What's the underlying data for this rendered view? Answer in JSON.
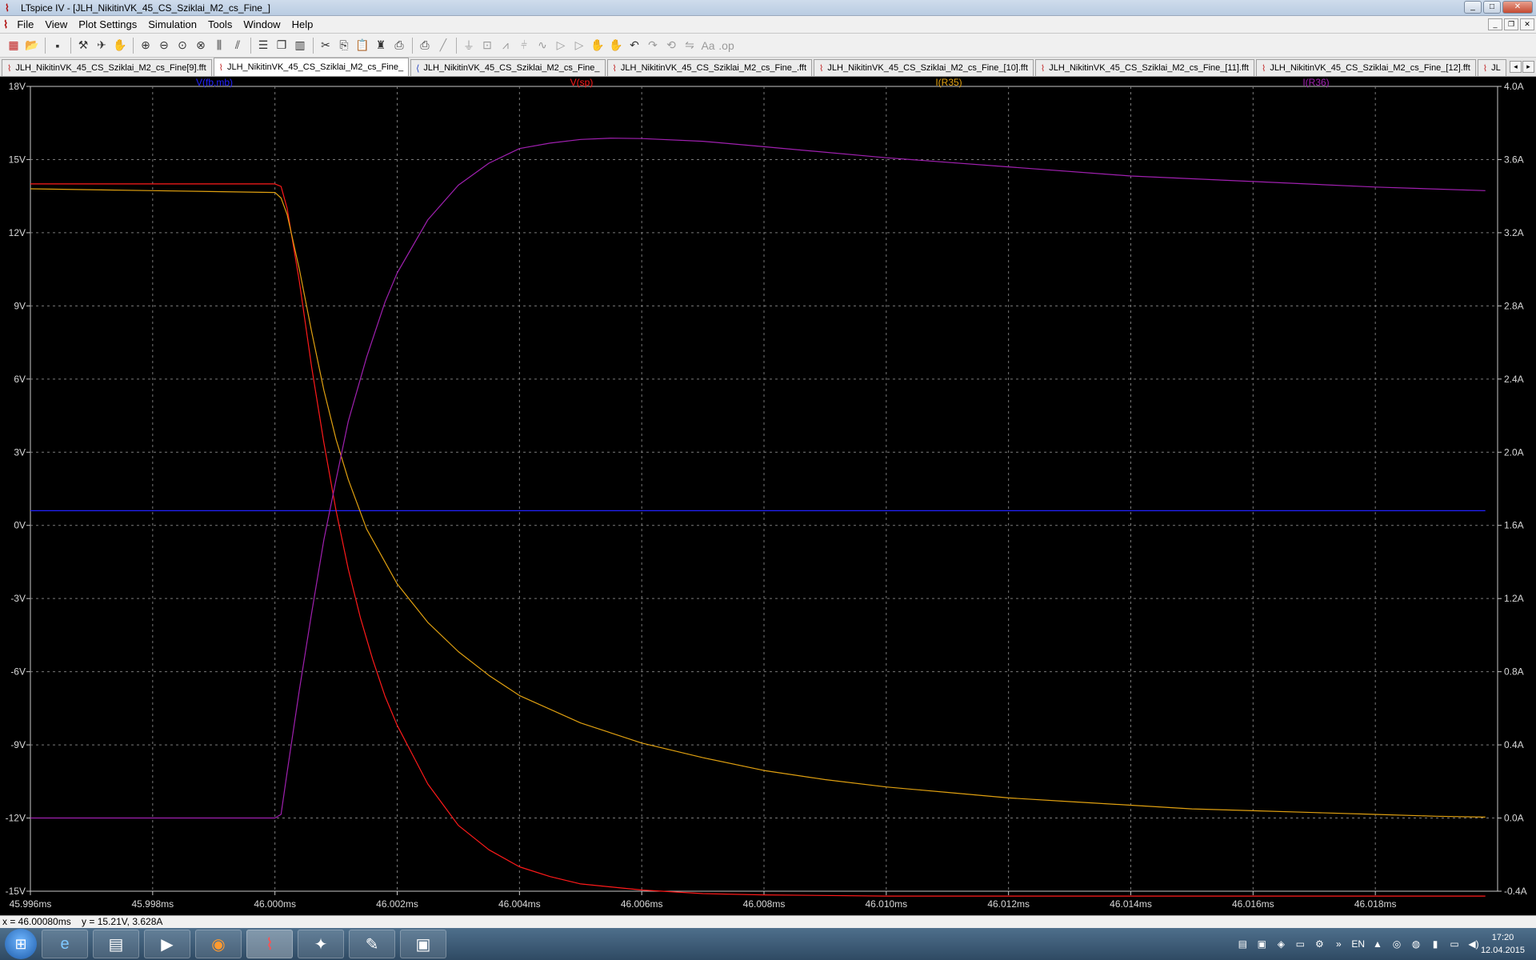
{
  "window": {
    "title": "LTspice IV - [JLH_NikitinVK_45_CS_Sziklai_M2_cs_Fine_]"
  },
  "menu": [
    "File",
    "View",
    "Plot Settings",
    "Simulation",
    "Tools",
    "Window",
    "Help"
  ],
  "toolbar_icons": [
    "new-schematic-icon",
    "open-icon",
    "save-icon",
    "control-panel-icon",
    "run-icon",
    "halt-icon",
    "zoom-in-icon",
    "zoom-out-icon",
    "zoom-full-icon",
    "zoom-cancel-icon",
    "autorange-icon",
    "autorange-y-icon",
    "tile-horizontal-icon",
    "cascade-icon",
    "tile-vertical-icon",
    "cut-icon",
    "copy-icon",
    "paste-icon",
    "find-icon",
    "print-preview-icon",
    "print-icon",
    "wire-icon",
    "ground-icon",
    "label-icon",
    "resistor-icon",
    "capacitor-icon",
    "inductor-icon",
    "diode-icon",
    "component-icon",
    "move-icon",
    "drag-icon",
    "undo-icon",
    "redo-icon",
    "rotate-icon",
    "mirror-icon",
    "text-icon",
    "spice-directive-icon"
  ],
  "tabs": [
    {
      "label": "JLH_NikitinVK_45_CS_Sziklai_M2_cs_Fine[9].fft",
      "active": false,
      "icon": "waveform-icon"
    },
    {
      "label": "JLH_NikitinVK_45_CS_Sziklai_M2_cs_Fine_",
      "active": true,
      "icon": "waveform-icon"
    },
    {
      "label": "JLH_NikitinVK_45_CS_Sziklai_M2_cs_Fine_",
      "active": false,
      "icon": "schematic-icon"
    },
    {
      "label": "JLH_NikitinVK_45_CS_Sziklai_M2_cs_Fine_.fft",
      "active": false,
      "icon": "waveform-icon"
    },
    {
      "label": "JLH_NikitinVK_45_CS_Sziklai_M2_cs_Fine_[10].fft",
      "active": false,
      "icon": "waveform-icon"
    },
    {
      "label": "JLH_NikitinVK_45_CS_Sziklai_M2_cs_Fine_[11].fft",
      "active": false,
      "icon": "waveform-icon"
    },
    {
      "label": "JLH_NikitinVK_45_CS_Sziklai_M2_cs_Fine_[12].fft",
      "active": false,
      "icon": "waveform-icon"
    },
    {
      "label": "JL",
      "active": false,
      "icon": "waveform-icon"
    }
  ],
  "chart_data": {
    "type": "line",
    "title": "",
    "xlabel": "",
    "ylabel": "",
    "x_unit": "ms",
    "xlim": [
      45.996,
      46.02
    ],
    "x_ticks": [
      "45.996ms",
      "45.998ms",
      "46.000ms",
      "46.002ms",
      "46.004ms",
      "46.006ms",
      "46.008ms",
      "46.010ms",
      "46.012ms",
      "46.014ms",
      "46.016ms",
      "46.018ms"
    ],
    "y_left": {
      "lim": [
        -15,
        18
      ],
      "ticks": [
        "18V",
        "15V",
        "12V",
        "9V",
        "6V",
        "3V",
        "0V",
        "-3V",
        "-6V",
        "-9V",
        "-12V",
        "-15V"
      ]
    },
    "y_right": {
      "lim": [
        -0.4,
        4.0
      ],
      "ticks": [
        "4.0A",
        "3.6A",
        "3.2A",
        "2.8A",
        "2.4A",
        "2.0A",
        "1.6A",
        "1.2A",
        "0.8A",
        "0.4A",
        "0.0A",
        "-0.4A"
      ]
    },
    "grid": true,
    "background": "#000000",
    "grid_color": "#7a7a7a",
    "axis_color": "#c8c8c8",
    "series": [
      {
        "name": "V(fb,mb)",
        "color": "#2222ff",
        "axis": "left",
        "x": [
          45.996,
          46.0198
        ],
        "y": [
          0.6,
          0.6
        ]
      },
      {
        "name": "V(sp)",
        "color": "#ff1a1a",
        "axis": "left",
        "x": [
          45.996,
          45.998,
          46.0,
          46.0001,
          46.0002,
          46.0004,
          46.0006,
          46.0008,
          46.001,
          46.0012,
          46.0014,
          46.0016,
          46.0018,
          46.002,
          46.0025,
          46.003,
          46.0035,
          46.004,
          46.0045,
          46.005,
          46.006,
          46.007,
          46.008,
          46.01,
          46.012,
          46.014,
          46.016,
          46.0198
        ],
        "y": [
          14.0,
          14.0,
          14.0,
          13.9,
          13.0,
          10.0,
          6.5,
          3.4,
          0.6,
          -1.8,
          -3.8,
          -5.5,
          -7.0,
          -8.2,
          -10.6,
          -12.3,
          -13.3,
          -14.0,
          -14.4,
          -14.7,
          -14.95,
          -15.1,
          -15.15,
          -15.2,
          -15.2,
          -15.2,
          -15.2,
          -15.2
        ]
      },
      {
        "name": "I(R35)",
        "color": "#e0a010",
        "axis": "right",
        "x": [
          45.996,
          45.998,
          46.0,
          46.0001,
          46.0002,
          46.0004,
          46.0006,
          46.0008,
          46.001,
          46.0012,
          46.0015,
          46.002,
          46.0025,
          46.003,
          46.0035,
          46.004,
          46.005,
          46.006,
          46.007,
          46.008,
          46.009,
          46.01,
          46.011,
          46.012,
          46.013,
          46.014,
          46.015,
          46.016,
          46.017,
          46.018,
          46.019,
          46.0198
        ],
        "y": [
          3.44,
          3.43,
          3.42,
          3.39,
          3.3,
          3.0,
          2.66,
          2.34,
          2.07,
          1.85,
          1.58,
          1.28,
          1.07,
          0.91,
          0.78,
          0.67,
          0.52,
          0.41,
          0.33,
          0.26,
          0.21,
          0.17,
          0.14,
          0.11,
          0.09,
          0.07,
          0.05,
          0.04,
          0.03,
          0.02,
          0.01,
          0.005
        ]
      },
      {
        "name": "I(R36)",
        "color": "#a020b0",
        "axis": "right",
        "x": [
          45.996,
          45.998,
          46.0,
          46.0001,
          46.0002,
          46.0004,
          46.0006,
          46.0008,
          46.001,
          46.0012,
          46.0015,
          46.0018,
          46.002,
          46.0025,
          46.003,
          46.0035,
          46.004,
          46.0045,
          46.005,
          46.0055,
          46.006,
          46.007,
          46.008,
          46.01,
          46.012,
          46.014,
          46.016,
          46.018,
          46.0198
        ],
        "y": [
          0.0,
          0.0,
          0.0,
          0.02,
          0.25,
          0.7,
          1.12,
          1.52,
          1.85,
          2.17,
          2.52,
          2.82,
          2.98,
          3.27,
          3.46,
          3.58,
          3.66,
          3.69,
          3.71,
          3.717,
          3.715,
          3.7,
          3.67,
          3.61,
          3.56,
          3.51,
          3.48,
          3.45,
          3.43
        ]
      }
    ]
  },
  "status": {
    "cursor": "x = 46.00080ms    y = 15.21V, 3.628A"
  },
  "taskbar": {
    "apps": [
      {
        "icon": "internet-explorer-icon",
        "glyph": "e"
      },
      {
        "icon": "file-explorer-icon",
        "glyph": "▤"
      },
      {
        "icon": "media-player-icon",
        "glyph": "▶"
      },
      {
        "icon": "firefox-icon",
        "glyph": "◉"
      },
      {
        "icon": "ltspice-icon",
        "glyph": "⌇"
      },
      {
        "icon": "fox-app-icon",
        "glyph": "✦"
      },
      {
        "icon": "paint-icon",
        "glyph": "✎"
      },
      {
        "icon": "image-viewer-icon",
        "glyph": "▣"
      }
    ],
    "lang": "EN",
    "time": "17:20",
    "date": "12.04.2015"
  }
}
